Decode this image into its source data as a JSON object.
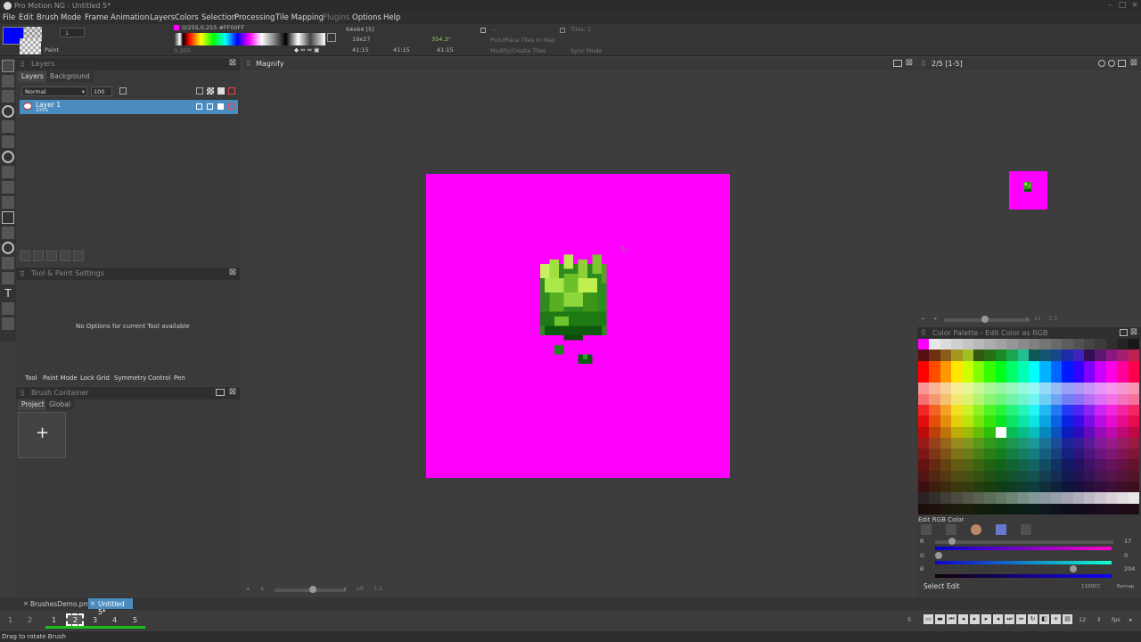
{
  "window": {
    "title": "Pro Motion NG : Untitled 5*"
  },
  "menu": [
    "File",
    "Edit",
    "Brush",
    "Mode",
    "Frame",
    "Animation",
    "Layers",
    "Colors",
    "Selection",
    "Processing",
    "Tile Mapping",
    "Plugins",
    "Options",
    "Help"
  ],
  "toolbar": {
    "brush_size": "1",
    "paint_label": "Paint",
    "color_readout": "0/255,0,255 #FF00FF",
    "color_range": "0-255",
    "size_readout": "64x64 [5]",
    "cursor_readout": "19x27",
    "angle_readout": "354.3°",
    "pos_a": "41:15",
    "pos_b": "41:15",
    "pos_c": "41:15",
    "tiles_label": "Tiles: 1",
    "pick_place": "Pick/Place Tiles in Map",
    "modify_create": "Modify/Create Tiles",
    "sync_mode": "Sync Mode",
    "dash": "---"
  },
  "layers_panel": {
    "title": "Layers",
    "tabs": [
      "Layers",
      "Background"
    ],
    "blend_mode": "Normal",
    "opacity": "100",
    "layer_name": "Layer 1",
    "layer_opacity": "100%"
  },
  "tool_settings": {
    "title": "Tool & Paint Settings",
    "message": "No Options for current Tool available",
    "tabs": [
      "Tool",
      "Paint Mode",
      "Lock Grid",
      "Symmetry",
      "Control",
      "Pen"
    ]
  },
  "brush_container": {
    "title": "Brush Container",
    "tabs": [
      "Project",
      "Global"
    ],
    "add_glyph": "+"
  },
  "canvas": {
    "title": "Magnify",
    "zoom_label": "x8",
    "ratio": "1:1",
    "bg_color": "#ff00ff"
  },
  "preview": {
    "title": "2/5 [1-5]",
    "zoom_label": "x1",
    "ratio": "1:1"
  },
  "palette": {
    "title": "Color Palette - Edit Color as RGB",
    "edit_title": "Edit RGB Color",
    "r_label": "R",
    "r_value": "17",
    "g_label": "G",
    "g_value": "0",
    "b_label": "B",
    "b_value": "204",
    "select_label": "Select",
    "edit_label": "Edit",
    "hex_value": "1100CC",
    "remap_label": "Remap"
  },
  "project_tabs": [
    "BrushesDemo.pmp",
    "Untitled 5*"
  ],
  "frames": [
    "1",
    "2",
    "1",
    "2",
    "3",
    "4",
    "5"
  ],
  "transport": {
    "fps_value": "12",
    "fps_label": "fps",
    "frame_field": "5"
  },
  "status": {
    "text": "Drag to rotate Brush"
  },
  "colors": {
    "accent_blue": "#4b8cc0",
    "magenta": "#ff00ff",
    "fg_color": "#0000ff"
  }
}
